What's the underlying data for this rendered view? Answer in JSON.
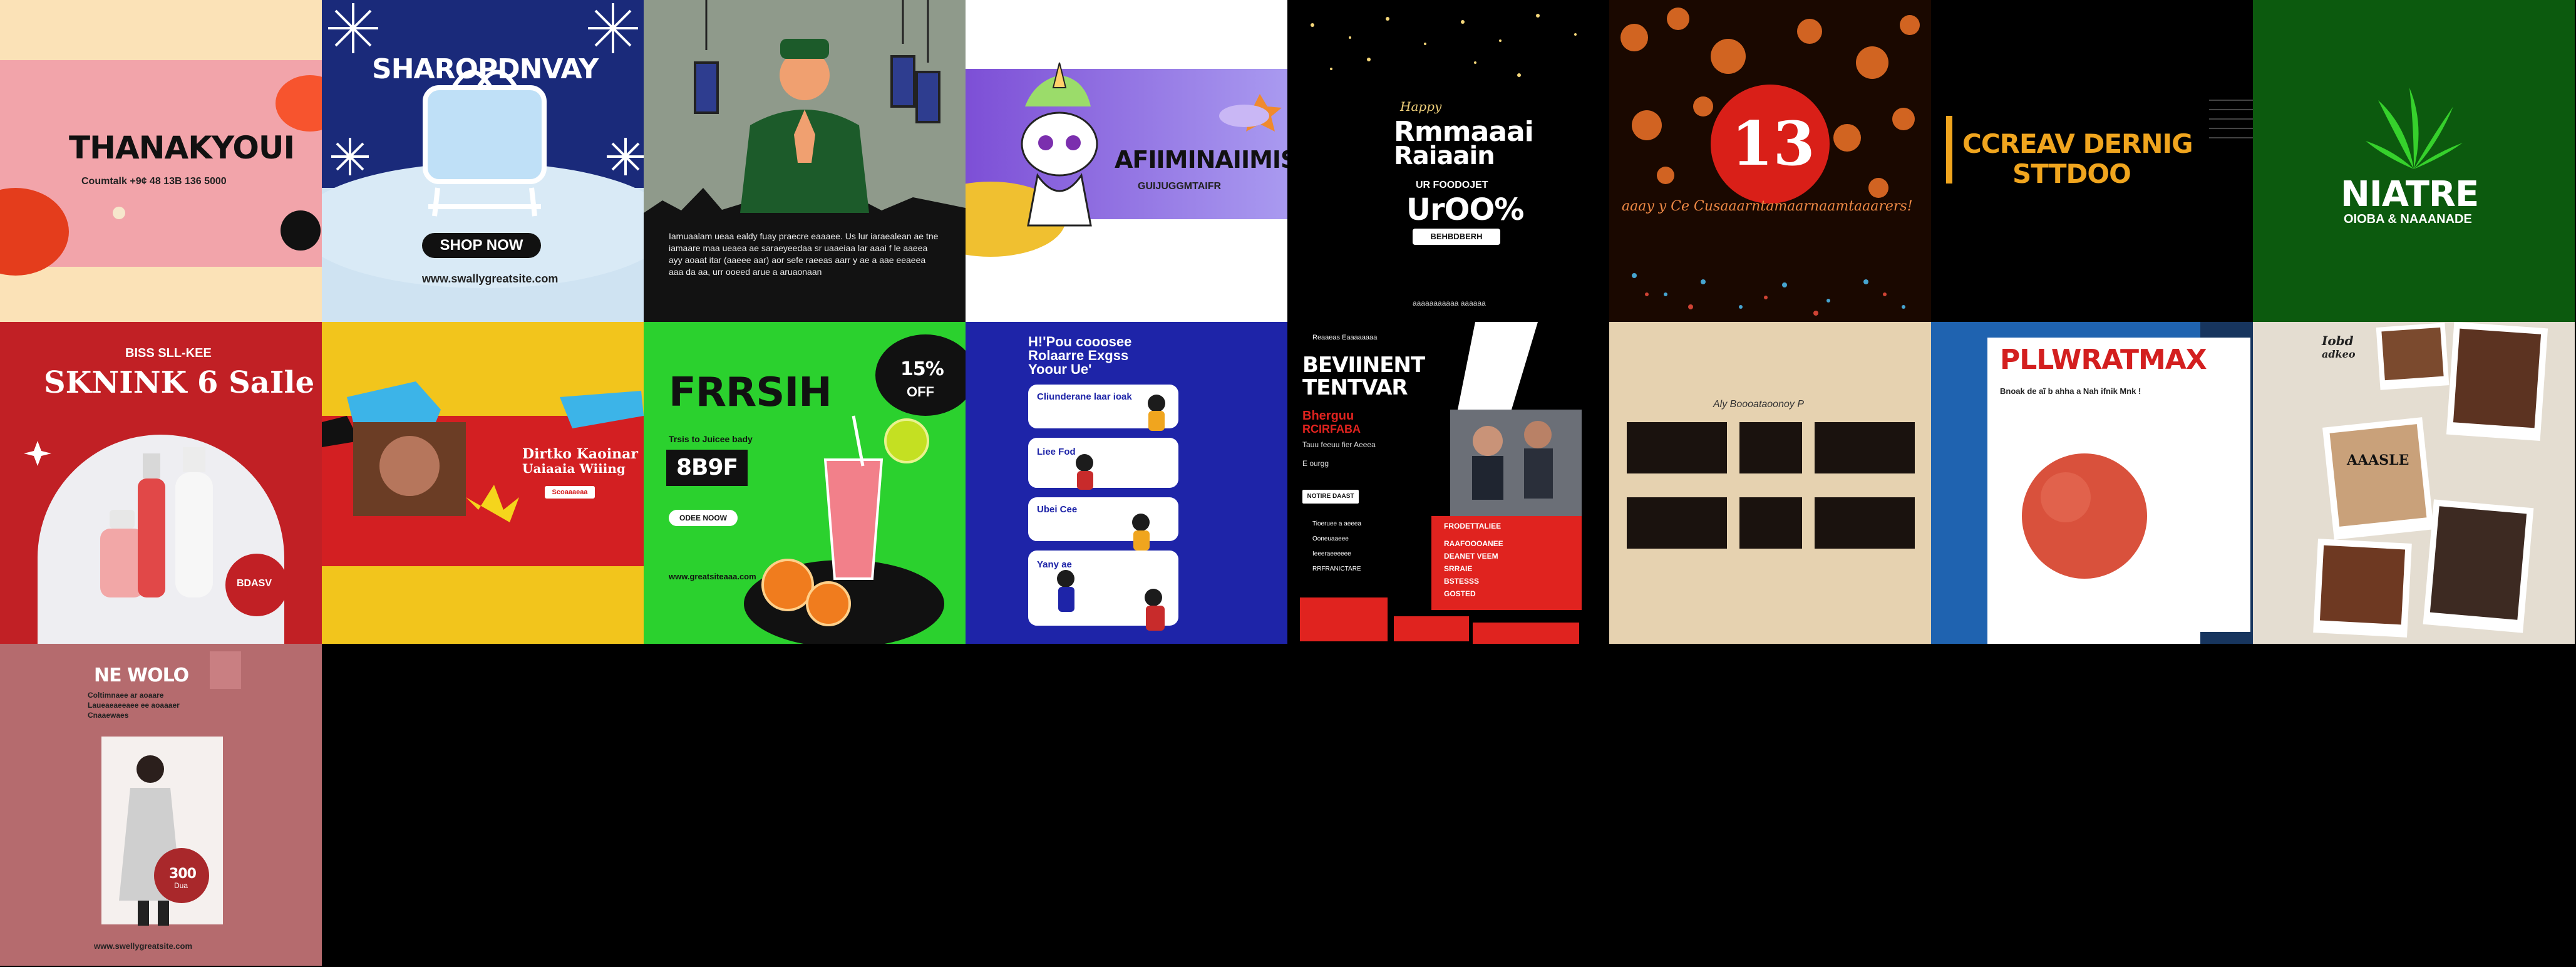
{
  "tiles": {
    "thank_you": {
      "title": "THANAKYOUI",
      "contact": "Coumtalk +9¢ 48 13B 136 5000"
    },
    "shopping_day": {
      "title": "SHAROPDNVAY",
      "button": "SHOP NOW",
      "url": "www.swallygreatsite.com"
    },
    "ramadan_prayer": {
      "body": "Iamuaalam ueaa ealdy fuay praecre eaaaee. Us lur iaraealean ae tne iamaare maa ueaea ae saraeyeedaa sr uaaeiaa lar aaai f le aaeea ayy aoaat itar (aaeee aar) aor sefe raeeas aarr y ae a aae eeaeea aaa da aa, urr ooeed arue a aruaonaan"
    },
    "unicorn": {
      "title": "AFIIMINAIIMIS",
      "subtitle": "GUIJUGGMTAIFR"
    },
    "happy_ramadan": {
      "small": "Happy",
      "title1": "Rmmaaai",
      "title2": "Raiaain",
      "off_label": "UR FOODOJET",
      "percent": "UrOO%",
      "button": "BEHBDBERH",
      "footer": "aaaaaaaaaaa aaaaaa"
    },
    "bokeh": {
      "number": "13",
      "caption": "aaay y Ce Cusaaarntamaarnaamtaaarers!"
    },
    "studio": {
      "title": "CCREAV DERNIG",
      "subtitle": "STTDOO"
    },
    "nature": {
      "title": "NIATRE",
      "subtitle": "OIOBA &  NAAANADE"
    },
    "skincare": {
      "small": "BISS SLL-KEE",
      "title": "SKNINK 6 SaIle",
      "badge": "BDASV"
    },
    "collage_red": {
      "headline": "Dirtko Kaoinar",
      "subhead": "Uaiaaia Wiiing",
      "button": "Scoaaaeaa"
    },
    "fresh": {
      "title": "FRRSIH",
      "discount": "15%",
      "off": "OFF",
      "sub": "Trsis to Juicee bady",
      "price": "8B9F",
      "button": "ODEE NOOW",
      "url": "www.greatsiteaaa.com"
    },
    "blue_list": {
      "heading1": "H!'Pou cooosee",
      "heading2": "Rolaarre Exgss",
      "heading3": "Yoour  Ue'",
      "items": [
        "Cliunderane laar ioak",
        "Liee Fod",
        "Ubei Cee",
        "Yany ae"
      ]
    },
    "business": {
      "logo": "Reaaeas Eaaaaaaaa",
      "title1": "BEVIINENT",
      "title2": "TENTVAR",
      "sub1": "Bherguu",
      "sub2": "RCIRFABA",
      "text": "Tauu feeuu fier Aeeea",
      "small": "E ourgg",
      "button": "NOTIRE DAAST",
      "list": [
        "Tioeruee a aeeea",
        "Ooneuaaeee",
        "Ieeeraeeeeee",
        "RRFRANICTARE"
      ],
      "red_box": [
        "FRODETTALIEE",
        "RAAFOOOANEE",
        "DEANET VEEM",
        "SRRAIE",
        "BSTESSS",
        "GOSTED"
      ]
    },
    "beige_gallery": {
      "heading": "Aly Boooataoonoy P"
    },
    "planet": {
      "title": "PLLWRATMAX",
      "subtitle": "Bnoak de aĩ b ahha a Nah ifnik Mnk !"
    },
    "polaroid": {
      "small1": "Iobd",
      "small2": "adkeo",
      "label": "AAASLE"
    },
    "new_world": {
      "title": "NE WOLO",
      "text1": "Coltimnaee ar aoaare",
      "text2": "Laueaeaeeaee ee aoaaaer",
      "text3": "Cnaaewaes",
      "price": "300",
      "price_sub": "Dua",
      "url": "www.swellygreatsite.com"
    }
  },
  "colors": {
    "black": "#000000",
    "pink": "#f0a3a8",
    "red": "#c41f24",
    "navy": "#1f2f9a",
    "green": "#2bd12e",
    "dark_green": "#0c5a0e",
    "yellow": "#f3c81a",
    "beige": "#e6d2b0",
    "orange": "#f0a51e"
  }
}
